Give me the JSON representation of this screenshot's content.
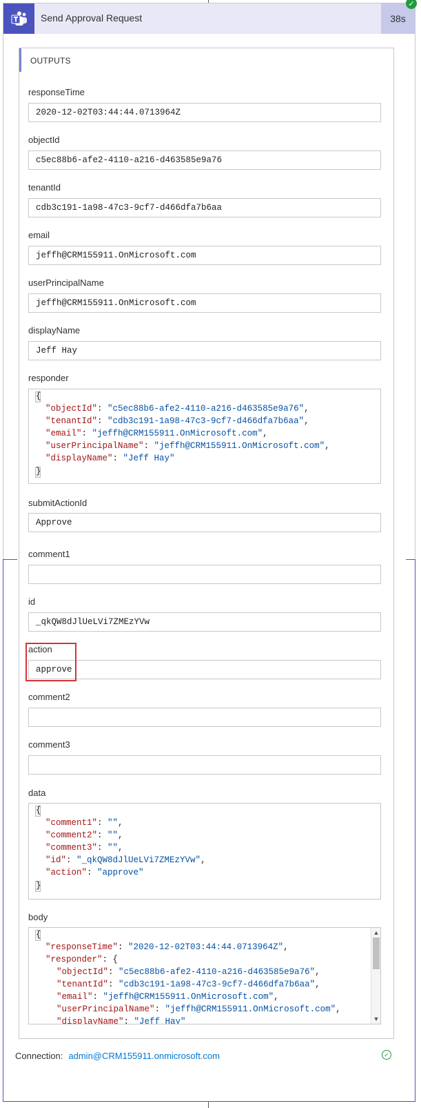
{
  "header": {
    "title": "Send Approval Request",
    "duration": "38s",
    "app_icon": "teams-icon",
    "status_icon": "check-circle-icon"
  },
  "outputs": {
    "title": "OUTPUTS",
    "fields": {
      "responseTime": {
        "label": "responseTime",
        "value": "2020-12-02T03:44:44.0713964Z"
      },
      "objectId": {
        "label": "objectId",
        "value": "c5ec88b6-afe2-4110-a216-d463585e9a76"
      },
      "tenantId": {
        "label": "tenantId",
        "value": "cdb3c191-1a98-47c3-9cf7-d466dfa7b6aa"
      },
      "email": {
        "label": "email",
        "value": "jeffh@CRM155911.OnMicrosoft.com"
      },
      "userPrincipalName": {
        "label": "userPrincipalName",
        "value": "jeffh@CRM155911.OnMicrosoft.com"
      },
      "displayName": {
        "label": "displayName",
        "value": "Jeff Hay"
      },
      "responder": {
        "label": "responder"
      },
      "submitActionId": {
        "label": "submitActionId",
        "value": "Approve"
      },
      "comment1": {
        "label": "comment1",
        "value": ""
      },
      "id": {
        "label": "id",
        "value": "_qkQW8dJlUeLVi7ZMEzYVw"
      },
      "action": {
        "label": "action",
        "value": "approve"
      },
      "comment2": {
        "label": "comment2",
        "value": ""
      },
      "comment3": {
        "label": "comment3",
        "value": ""
      },
      "data": {
        "label": "data"
      },
      "body": {
        "label": "body"
      }
    },
    "responder_json": {
      "open": "{",
      "close": "}",
      "lines": [
        {
          "key": "\"objectId\"",
          "val": "\"c5ec88b6-afe2-4110-a216-d463585e9a76\"",
          "tail": ","
        },
        {
          "key": "\"tenantId\"",
          "val": "\"cdb3c191-1a98-47c3-9cf7-d466dfa7b6aa\"",
          "tail": ","
        },
        {
          "key": "\"email\"",
          "val": "\"jeffh@CRM155911.OnMicrosoft.com\"",
          "tail": ","
        },
        {
          "key": "\"userPrincipalName\"",
          "val": "\"jeffh@CRM155911.OnMicrosoft.com\"",
          "tail": ","
        },
        {
          "key": "\"displayName\"",
          "val": "\"Jeff Hay\"",
          "tail": ""
        }
      ]
    },
    "data_json": {
      "open": "{",
      "close": "}",
      "lines": [
        {
          "key": "\"comment1\"",
          "val": "\"\"",
          "tail": ","
        },
        {
          "key": "\"comment2\"",
          "val": "\"\"",
          "tail": ","
        },
        {
          "key": "\"comment3\"",
          "val": "\"\"",
          "tail": ","
        },
        {
          "key": "\"id\"",
          "val": "\"_qkQW8dJlUeLVi7ZMEzYVw\"",
          "tail": ","
        },
        {
          "key": "\"action\"",
          "val": "\"approve\"",
          "tail": ""
        }
      ]
    },
    "body_json": {
      "open": "{",
      "line1_key": "\"responseTime\"",
      "line1_val": "\"2020-12-02T03:44:44.0713964Z\"",
      "line2_key": "\"responder\"",
      "line2_tail": "{",
      "lines": [
        {
          "key": "\"objectId\"",
          "val": "\"c5ec88b6-afe2-4110-a216-d463585e9a76\"",
          "tail": ","
        },
        {
          "key": "\"tenantId\"",
          "val": "\"cdb3c191-1a98-47c3-9cf7-d466dfa7b6aa\"",
          "tail": ","
        },
        {
          "key": "\"email\"",
          "val": "\"jeffh@CRM155911.OnMicrosoft.com\"",
          "tail": ","
        },
        {
          "key": "\"userPrincipalName\"",
          "val": "\"jeffh@CRM155911.OnMicrosoft.com\"",
          "tail": ","
        },
        {
          "key": "\"displayName\"",
          "val": "\"Jeff Hay\"",
          "tail": ""
        }
      ]
    }
  },
  "connection": {
    "label": "Connection:",
    "account": "admin@CRM155911.onmicrosoft.com",
    "status_icon": "check-circle-icon"
  },
  "colors": {
    "teams_purple": "#4b53bc",
    "success_green": "#1e9b3e",
    "highlight_red": "#d13438",
    "json_key": "#a31515",
    "json_value": "#0451a5",
    "link_blue": "#0078d4"
  }
}
